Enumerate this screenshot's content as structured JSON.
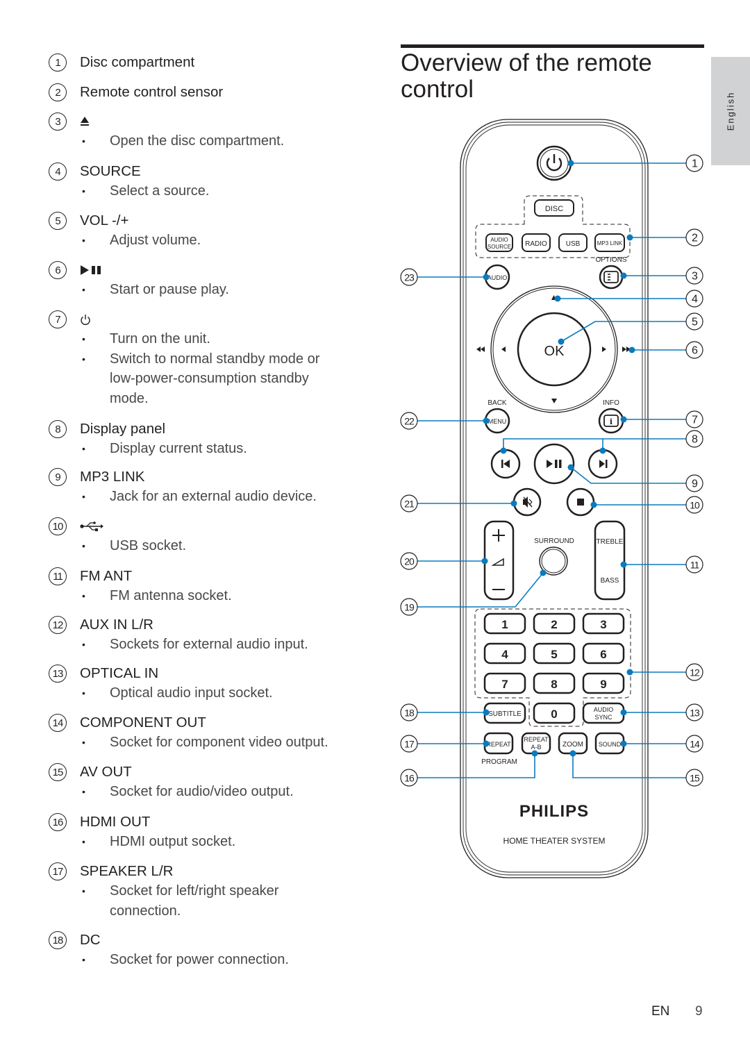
{
  "page": {
    "heading": "Overview of the remote control",
    "language_tab": "English",
    "footer_lang": "EN",
    "page_number": "9",
    "callout_color": "#0a7bbd"
  },
  "items": [
    {
      "num": "1",
      "title": "Disc compartment",
      "bullets": []
    },
    {
      "num": "2",
      "title": "Remote control sensor",
      "bullets": []
    },
    {
      "num": "3",
      "title": "",
      "icon": "eject-icon",
      "bullets": [
        "Open the disc compartment."
      ]
    },
    {
      "num": "4",
      "title": "SOURCE",
      "bullets": [
        "Select a source."
      ]
    },
    {
      "num": "5",
      "title": "VOL -/+",
      "bullets": [
        "Adjust volume."
      ]
    },
    {
      "num": "6",
      "title": "",
      "icon": "play-pause-icon",
      "bullets": [
        "Start or pause play."
      ]
    },
    {
      "num": "7",
      "title": "",
      "icon": "power-icon",
      "bullets": [
        "Turn on the unit.",
        "Switch to normal standby mode or low-power-consumption standby mode."
      ]
    },
    {
      "num": "8",
      "title": "Display panel",
      "bullets": [
        "Display current status."
      ]
    },
    {
      "num": "9",
      "title": "MP3 LINK",
      "bullets": [
        "Jack for an external audio device."
      ]
    },
    {
      "num": "10",
      "title": "",
      "icon": "usb-icon",
      "bullets": [
        "USB socket."
      ]
    },
    {
      "num": "11",
      "title": "FM ANT",
      "bullets": [
        "FM antenna socket."
      ]
    },
    {
      "num": "12",
      "title": "AUX IN L/R",
      "bullets": [
        "Sockets for external audio input."
      ]
    },
    {
      "num": "13",
      "title": "OPTICAL IN",
      "bullets": [
        "Optical audio input socket."
      ]
    },
    {
      "num": "14",
      "title": "COMPONENT OUT",
      "bullets": [
        "Socket for component video output."
      ]
    },
    {
      "num": "15",
      "title": "AV OUT",
      "bullets": [
        "Socket for audio/video output."
      ]
    },
    {
      "num": "16",
      "title": "HDMI OUT",
      "bullets": [
        "HDMI output socket."
      ]
    },
    {
      "num": "17",
      "title": "SPEAKER L/R",
      "bullets": [
        "Socket for left/right speaker connection."
      ]
    },
    {
      "num": "18",
      "title": "DC",
      "bullets": [
        "Socket for power connection."
      ]
    }
  ],
  "remote": {
    "buttons": {
      "disc": "DISC",
      "audio_source_1": "AUDIO",
      "audio_source_2": "SOURCE",
      "radio": "RADIO",
      "usb": "USB",
      "mp3link": "MP3 LINK",
      "options": "OPTIONS",
      "audio": "AUDIO",
      "ok": "OK",
      "back": "BACK",
      "info": "INFO",
      "menu": "MENU",
      "info_glyph": "i",
      "surround": "SURROUND",
      "treble": "TREBLE",
      "bass": "BASS",
      "keypad": [
        "1",
        "2",
        "3",
        "4",
        "5",
        "6",
        "7",
        "8",
        "9"
      ],
      "zero": "0",
      "subtitle": "SUBTITLE",
      "audio_sync_1": "AUDIO",
      "audio_sync_2": "SYNC",
      "repeat": "REPEAT",
      "program": "PROGRAM",
      "repeat_ab_1": "REPEAT",
      "repeat_ab_2": "A-B",
      "zoom": "ZOOM",
      "sound": "SOUND"
    },
    "brand": "PHILIPS",
    "product": "HOME THEATER SYSTEM",
    "callouts_right": [
      "1",
      "2",
      "3",
      "4",
      "5",
      "6",
      "7",
      "8",
      "9",
      "10",
      "11",
      "12",
      "13",
      "14",
      "15"
    ],
    "callouts_left": [
      "23",
      "22",
      "21",
      "20",
      "19",
      "18",
      "17",
      "16"
    ]
  }
}
